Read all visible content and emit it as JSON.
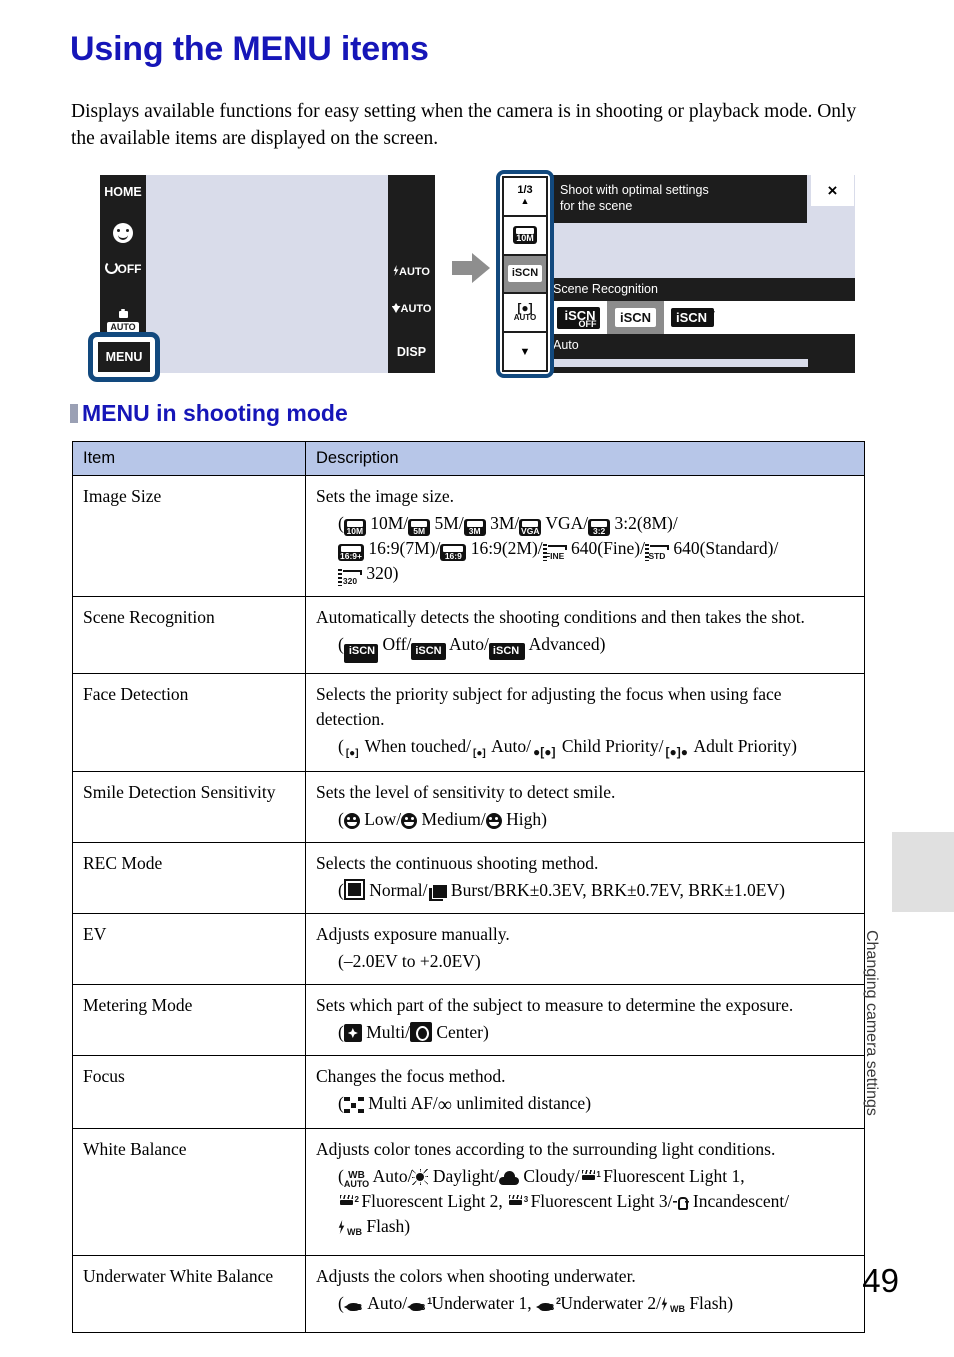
{
  "page": {
    "title": "Using the MENU items",
    "intro": "Displays available functions for easy setting when the camera is in shooting or playback mode. Only the available items are displayed on the screen.",
    "section_heading": "MENU in shooting mode",
    "page_number": "49",
    "side_tab_label": "Changing camera settings"
  },
  "figure": {
    "left_screen": {
      "home_label": "HOME",
      "smile_icon": "smile-shutter-icon",
      "selftimer_label": "OFF",
      "shootmode_label": "AUTO",
      "menu_label": "MENU",
      "flash_label": "AUTO",
      "macro_label": "AUTO",
      "disp_label": "DISP"
    },
    "arrow_icon": "right-arrow-icon",
    "right_screen": {
      "page_indicator": "1/3",
      "up_arrow_icon": "chevron-up-icon",
      "down_arrow_icon": "chevron-down-icon",
      "image_size_label": "10M",
      "scene_recognition_icon": "iSCN",
      "face_detection_label": "AUTO",
      "tip_line1": "Shoot with optimal settings",
      "tip_line2": "for the scene",
      "close_label": "×",
      "setting_title": "Scene Recognition",
      "options": [
        {
          "label": "iSCN",
          "sub": "OFF",
          "selected": false
        },
        {
          "label": "iSCN",
          "sub": "",
          "selected": true
        },
        {
          "label": "iSCN",
          "sub": "+",
          "selected": false
        }
      ],
      "current_value": "Auto"
    }
  },
  "table": {
    "headers": {
      "item": "Item",
      "description": "Description"
    },
    "rows": [
      {
        "item": "Image Size",
        "desc": "Sets the image size.",
        "options_text": "( 10M/ 5M/ 3M/ VGA/ 3:2(8M)/ 16:9(7M)/ 16:9(2M)/ 640(Fine)/ 640(Standard)/ 320)",
        "opt_10m": "10M",
        "opt_5m": "5M",
        "opt_3m": "3M",
        "opt_vga": "VGA",
        "opt_32": "3:2(8M)",
        "opt_169_7": "16:9(7M)",
        "opt_169_2": "16:9(2M)",
        "opt_640f": "640(Fine)",
        "opt_640s": "640(Standard)",
        "opt_320": "320",
        "ic_10m": "10M",
        "ic_5m": "5M",
        "ic_3m": "3M",
        "ic_vga": "VGA",
        "ic_32": "3:2",
        "ic_169p": "16:9+",
        "ic_169": "16:9",
        "ic_fine": "FINE",
        "ic_std": "STD",
        "ic_320": "320"
      },
      {
        "item": "Scene Recognition",
        "desc": "Automatically detects the shooting conditions and then takes the shot.",
        "opt_off": "Off",
        "opt_auto": "Auto",
        "opt_adv": "Advanced"
      },
      {
        "item": "Face Detection",
        "desc": "Selects the priority subject for adjusting the focus when using face detection.",
        "opt_touched": "When touched",
        "opt_auto": "Auto",
        "opt_child": "Child Priority",
        "opt_adult": "Adult Priority"
      },
      {
        "item": "Smile Detection Sensitivity",
        "desc": "Sets the level of sensitivity to detect smile.",
        "opt_low": "Low",
        "opt_med": "Medium",
        "opt_high": "High"
      },
      {
        "item": "REC Mode",
        "desc": "Selects the continuous shooting method.",
        "opt_normal": "Normal",
        "opt_burst": "Burst/BRK±0.3EV, BRK±0.7EV, BRK±1.0EV"
      },
      {
        "item": "EV",
        "desc": "Adjusts exposure manually.",
        "opt_range": "(–2.0EV to +2.0EV)"
      },
      {
        "item": "Metering Mode",
        "desc": "Sets which part of the subject to measure to determine the exposure.",
        "opt_multi": "Multi",
        "opt_center": "Center"
      },
      {
        "item": "Focus",
        "desc": "Changes the focus method.",
        "opt_multiaf": "Multi AF",
        "opt_unlimited": "unlimited distance"
      },
      {
        "item": "White Balance",
        "desc": "Adjusts color tones according to the surrounding light conditions.",
        "opt_auto": "Auto",
        "opt_daylight": "Daylight",
        "opt_cloudy": "Cloudy",
        "opt_fl1": "Fluorescent Light 1,",
        "opt_fl2": "Fluorescent Light 2,",
        "opt_fl3": "Fluorescent Light 3/",
        "opt_incand": "Incandescent/",
        "opt_flash": "Flash)",
        "wb_label": "WB",
        "wb_auto_label": "AUTO"
      },
      {
        "item": "Underwater White Balance",
        "desc": "Adjusts the colors when shooting underwater.",
        "opt_auto": "Auto",
        "opt_uw1": "Underwater 1,",
        "opt_uw2": "Underwater 2/",
        "opt_flash": "Flash)",
        "wb_label": "WB"
      }
    ]
  }
}
